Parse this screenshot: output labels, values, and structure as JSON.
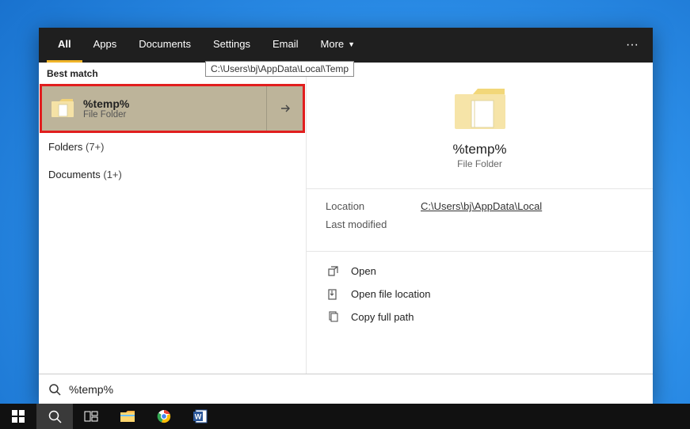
{
  "tabs": {
    "all": "All",
    "apps": "Apps",
    "documents": "Documents",
    "settings": "Settings",
    "email": "Email",
    "more": "More"
  },
  "tooltip_path": "C:\\Users\\bj\\AppData\\Local\\Temp",
  "best_match_header": "Best match",
  "result": {
    "title": "%temp%",
    "subtitle": "File Folder"
  },
  "categories": {
    "folders_label": "Folders",
    "folders_count": "(7+)",
    "documents_label": "Documents",
    "documents_count": "(1+)"
  },
  "preview": {
    "title": "%temp%",
    "subtitle": "File Folder",
    "location_label": "Location",
    "location_value": "C:\\Users\\bj\\AppData\\Local",
    "last_modified_label": "Last modified",
    "last_modified_value": ""
  },
  "actions": {
    "open": "Open",
    "open_file_location": "Open file location",
    "copy_full_path": "Copy full path"
  },
  "search_query": "%temp%"
}
